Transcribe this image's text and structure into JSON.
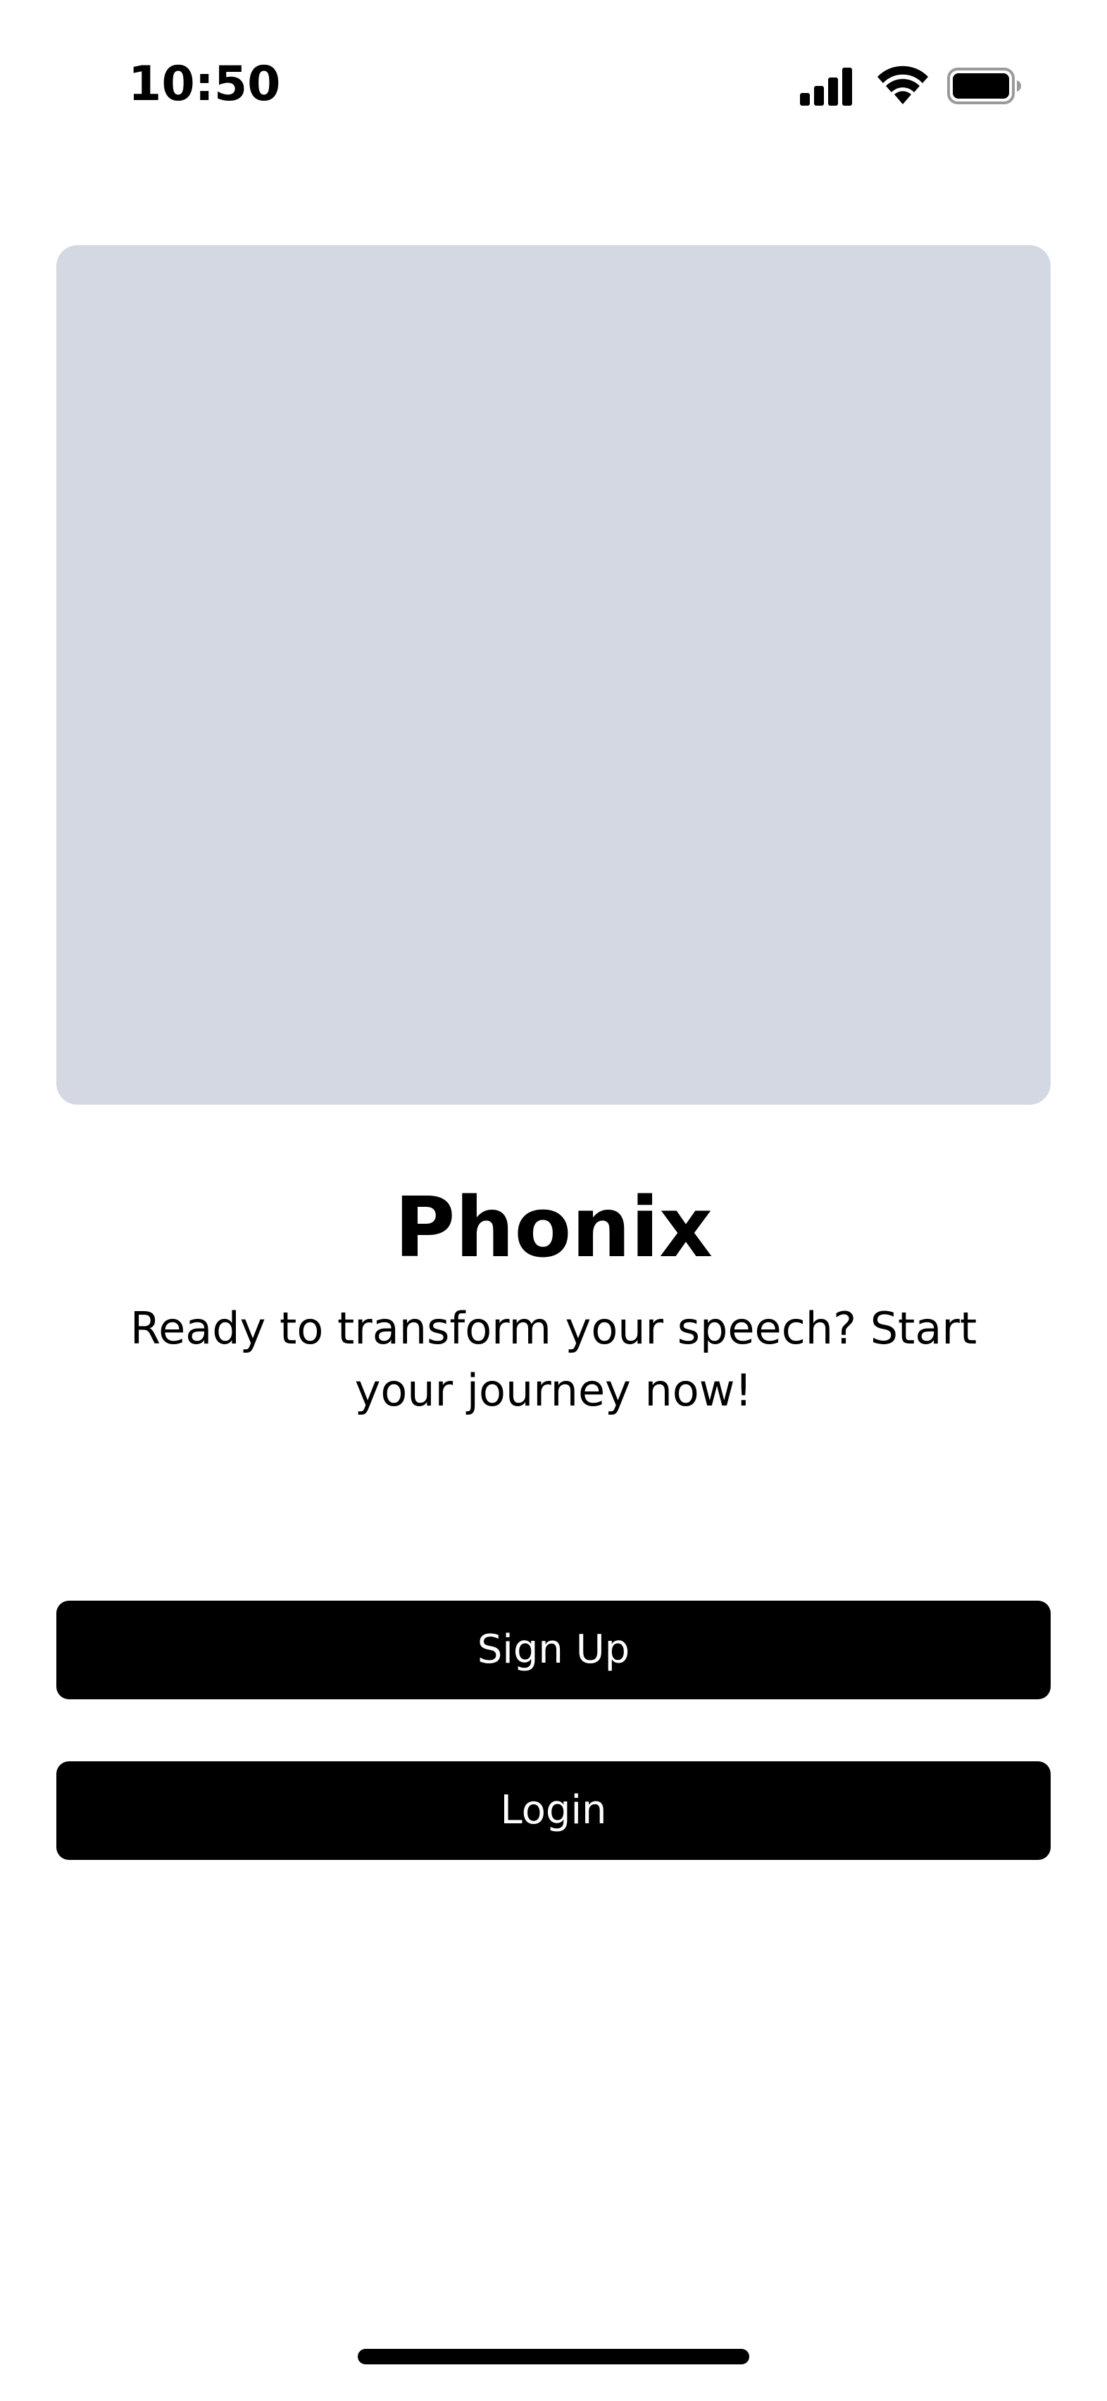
{
  "status_bar": {
    "time": "10:50",
    "icons": [
      "cellular-signal-icon",
      "wifi-icon",
      "battery-icon"
    ]
  },
  "hero": {
    "background_color": "#d4d8e2"
  },
  "app": {
    "title": "Phonix",
    "tagline": "Ready to transform your speech? Start your journey now!"
  },
  "actions": {
    "signup_label": "Sign Up",
    "login_label": "Login"
  },
  "colors": {
    "primary_button": "#000000",
    "button_text": "#ffffff",
    "placeholder": "#d4d8e2"
  }
}
